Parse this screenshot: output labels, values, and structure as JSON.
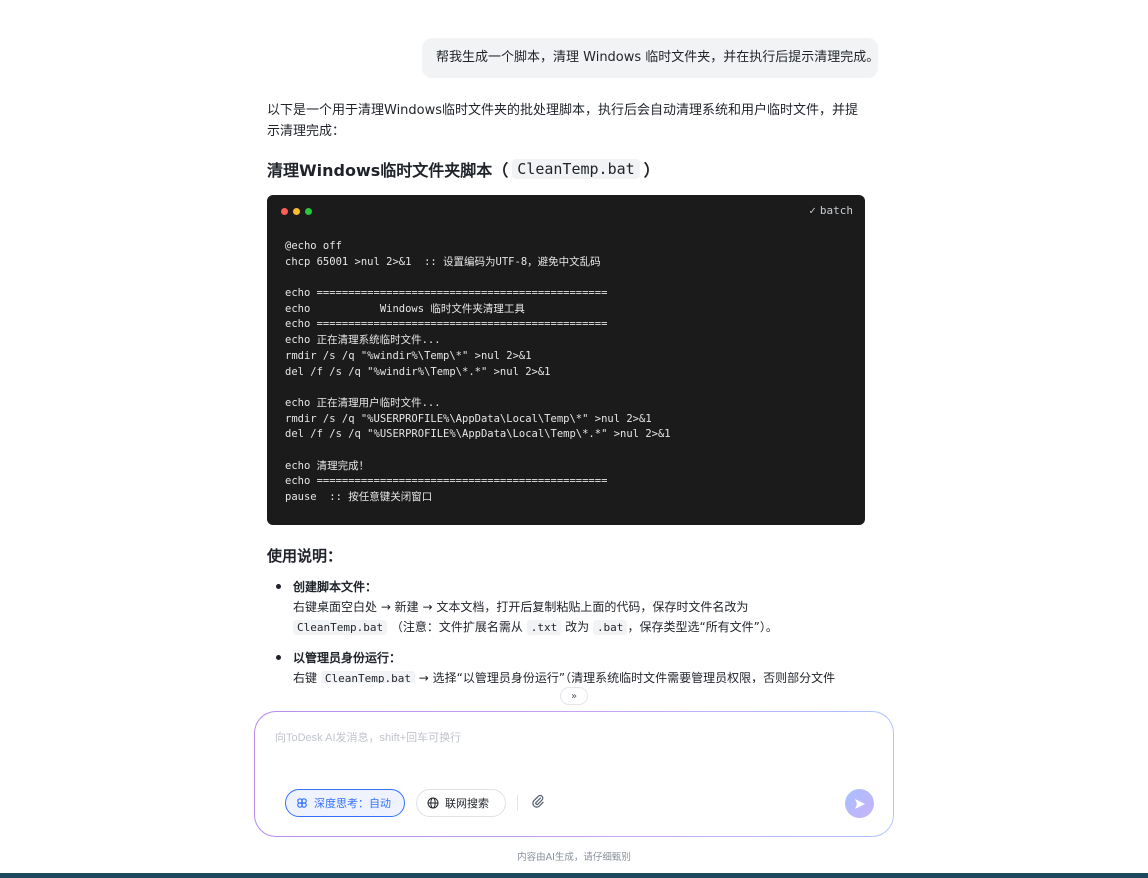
{
  "user_message": "帮我生成一个脚本，清理 Windows 临时文件夹，并在执行后提示清理完成。",
  "answer": {
    "intro": "以下是一个用于清理Windows临时文件夹的批处理脚本，执行后会自动清理系统和用户临时文件，并提示清理完成：",
    "title_prefix": "清理Windows临时文件夹脚本（",
    "title_code": "CleanTemp.bat",
    "title_suffix": "）",
    "code_block": {
      "language": "batch",
      "lines": [
        "@echo off",
        "chcp 65001 >nul 2>&1  :: 设置编码为UTF-8，避免中文乱码",
        "",
        "echo ==============================================",
        "echo           Windows 临时文件夹清理工具",
        "echo ==============================================",
        "echo 正在清理系统临时文件...",
        "rmdir /s /q \"%windir%\\Temp\\*\" >nul 2>&1",
        "del /f /s /q \"%windir%\\Temp\\*.*\" >nul 2>&1",
        "",
        "echo 正在清理用户临时文件...",
        "rmdir /s /q \"%USERPROFILE%\\AppData\\Local\\Temp\\*\" >nul 2>&1",
        "del /f /s /q \"%USERPROFILE%\\AppData\\Local\\Temp\\*.*\" >nul 2>&1",
        "",
        "echo 清理完成！",
        "echo ==============================================",
        "pause  :: 按任意键关闭窗口"
      ]
    },
    "usage_title": "使用说明：",
    "bullets": [
      {
        "title": "创建脚本文件：",
        "line1": "右键桌面空白处 → 新建 → 文本文档，打开后复制粘贴上面的代码，保存时文件名改为",
        "code1": "CleanTemp.bat",
        "text2": "（注意：文件扩展名需从",
        "code2": ".txt",
        "text3": "改为",
        "code3": ".bat",
        "text4": "，保存类型选“所有文件”）。"
      },
      {
        "title": "以管理员身份运行：",
        "text1": "右键",
        "code1": "CleanTemp.bat",
        "text2": "→ 选择“以管理员身份运行”（清理系统临时文件需要管理员权限，否则部分文件"
      }
    ]
  },
  "composer": {
    "placeholder": "向ToDesk AI发消息，shift+回车可换行",
    "deep_think_label": "深度思考：自动",
    "web_search_label": "联网搜索"
  },
  "disclaimer": "内容由AI生成，请仔细甄别",
  "icons": {
    "deep_think": "brain-icon",
    "web_search": "globe-icon",
    "attach": "paperclip-icon",
    "send": "send-icon",
    "scroll_down": "chevron-double-down-icon"
  },
  "colors": {
    "accent": "#3370ff",
    "code_bg": "#1b1b1b",
    "bottom_bar": "#1d4a5e"
  }
}
